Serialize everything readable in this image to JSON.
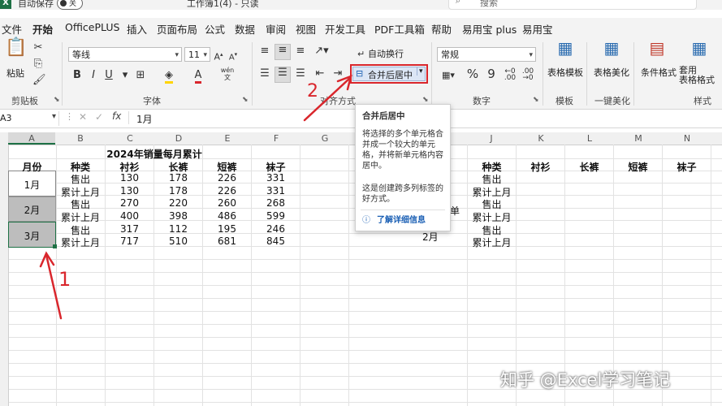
{
  "titlebar": {
    "autosave_label": "自动保存",
    "toggle_state": "关",
    "doc_title": "工作簿1(4) - 只读",
    "search_placeholder": "搜索"
  },
  "tabs": [
    {
      "label": "文件"
    },
    {
      "label": "开始"
    },
    {
      "label": "OfficePLUS"
    },
    {
      "label": "插入"
    },
    {
      "label": "页面布局"
    },
    {
      "label": "公式"
    },
    {
      "label": "数据"
    },
    {
      "label": "审阅"
    },
    {
      "label": "视图"
    },
    {
      "label": "开发工具"
    },
    {
      "label": "PDF工具箱"
    },
    {
      "label": "帮助"
    },
    {
      "label": "易用宝 plus"
    },
    {
      "label": "易用宝"
    }
  ],
  "ribbon": {
    "paste_label": "粘贴",
    "clipboard_label": "剪贴板",
    "font_name": "等线",
    "font_size": "11",
    "font_group_label": "字体",
    "wrap_text_label": "自动换行",
    "merge_center_label": "合并后居中",
    "align_group_label": "对齐方式",
    "number_format": "常规",
    "number_group_label": "数字",
    "table_template_label": "表格模板",
    "template_group_label": "模板",
    "table_beautify_label": "表格美化",
    "beautify_group_label": "一键美化",
    "cond_format_label": "条件格式",
    "apply_table_label": "套用\n表格格式",
    "style_group_label": "样式",
    "wen_label": "wén\n文"
  },
  "formula_bar": {
    "name_box": "A3",
    "fx": "fx",
    "value": "1月"
  },
  "columns": [
    "A",
    "B",
    "C",
    "D",
    "E",
    "F",
    "G",
    "H",
    "I",
    "J",
    "K",
    "L",
    "M",
    "N"
  ],
  "sheet": {
    "title": "2024年销量每月累计",
    "headers": [
      "月份",
      "种类",
      "衬衫",
      "长裤",
      "短裤",
      "袜子"
    ],
    "months": [
      "1月",
      "2月",
      "3月"
    ],
    "rows": [
      [
        "售出",
        "130",
        "178",
        "226",
        "331"
      ],
      [
        "累计上月",
        "130",
        "178",
        "226",
        "331"
      ],
      [
        "售出",
        "270",
        "220",
        "260",
        "268"
      ],
      [
        "累计上月",
        "400",
        "398",
        "486",
        "599"
      ],
      [
        "售出",
        "317",
        "112",
        "195",
        "246"
      ],
      [
        "累计上月",
        "717",
        "510",
        "681",
        "845"
      ]
    ],
    "right_headers": [
      "种类",
      "衬衫",
      "长裤",
      "短裤",
      "袜子"
    ],
    "right_types": [
      "售出",
      "累计上月",
      "售出",
      "累计上月",
      "售出",
      "累计上月"
    ],
    "right_month_label": "2月",
    "partial_text": "单"
  },
  "tooltip": {
    "title": "合并后居中",
    "line1": "将选择的多个单元格合",
    "line2": "并成一个较大的单元",
    "line3": "格，并将新单元格内容",
    "line4": "居中。",
    "line5": "这是创建跨多列标签的",
    "line6": "好方式。",
    "link": "了解详细信息"
  },
  "annotations": {
    "label1": "1",
    "label2": "2"
  },
  "watermark": "知乎 @Excel学习笔记",
  "colors": {
    "accent": "#1e7145",
    "annotation_red": "#d9262c",
    "selection_gray": "#bdbdbd",
    "link_blue": "#1a5fb4"
  }
}
